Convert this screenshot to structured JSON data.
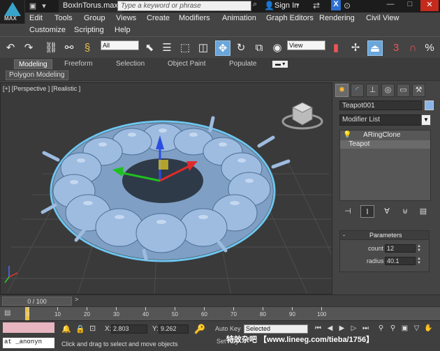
{
  "app": {
    "logo_text": "MAX",
    "doc_title": "BoxInTorus.max",
    "search_placeholder": "Type a keyword or phrase",
    "signin": "Sign In",
    "window_buttons": [
      "—",
      "□",
      "✕"
    ]
  },
  "menu": {
    "row1": [
      "Edit",
      "Tools",
      "Group",
      "Views",
      "Create",
      "Modifiers",
      "Animation",
      "Graph Editors",
      "Rendering",
      "Civil View"
    ],
    "row2": [
      "Customize",
      "Scripting",
      "Help"
    ]
  },
  "toolbar": {
    "filter": "All",
    "view": "View"
  },
  "ribbon": {
    "tabs": [
      "Modeling",
      "Freeform",
      "Selection",
      "Object Paint",
      "Populate"
    ],
    "active_tab": "Modeling",
    "panel_button": "Polygon Modeling"
  },
  "viewport": {
    "label": "[+] [Perspective ] [Realistic ]",
    "object_color": "#8fb3da"
  },
  "command_panel": {
    "object_name": "Teapot001",
    "object_color": "#8ab4e6",
    "modifier_list": "Modifier List",
    "stack": [
      "ARingClone",
      "Teapot"
    ],
    "params_title": "Parameters",
    "count_label": "count",
    "count_value": "12",
    "radius_label": "radius",
    "radius_value": "40.1"
  },
  "timeline": {
    "slider_text": "0 / 100",
    "ticks": [
      "0",
      "10",
      "20",
      "30",
      "40",
      "50",
      "60",
      "70",
      "80",
      "90",
      "100"
    ]
  },
  "status": {
    "script_text": "at _anonyn",
    "x_label": "X:",
    "x_value": "2.803",
    "y_label": "Y:",
    "y_value": "9.262",
    "autokey": "Auto Key",
    "setkey": "Set Key",
    "selected": "Selected",
    "message": "Click and drag to select and move objects"
  },
  "watermark": "特效杂吧 【www.lineeg.com/tieba/1756】"
}
